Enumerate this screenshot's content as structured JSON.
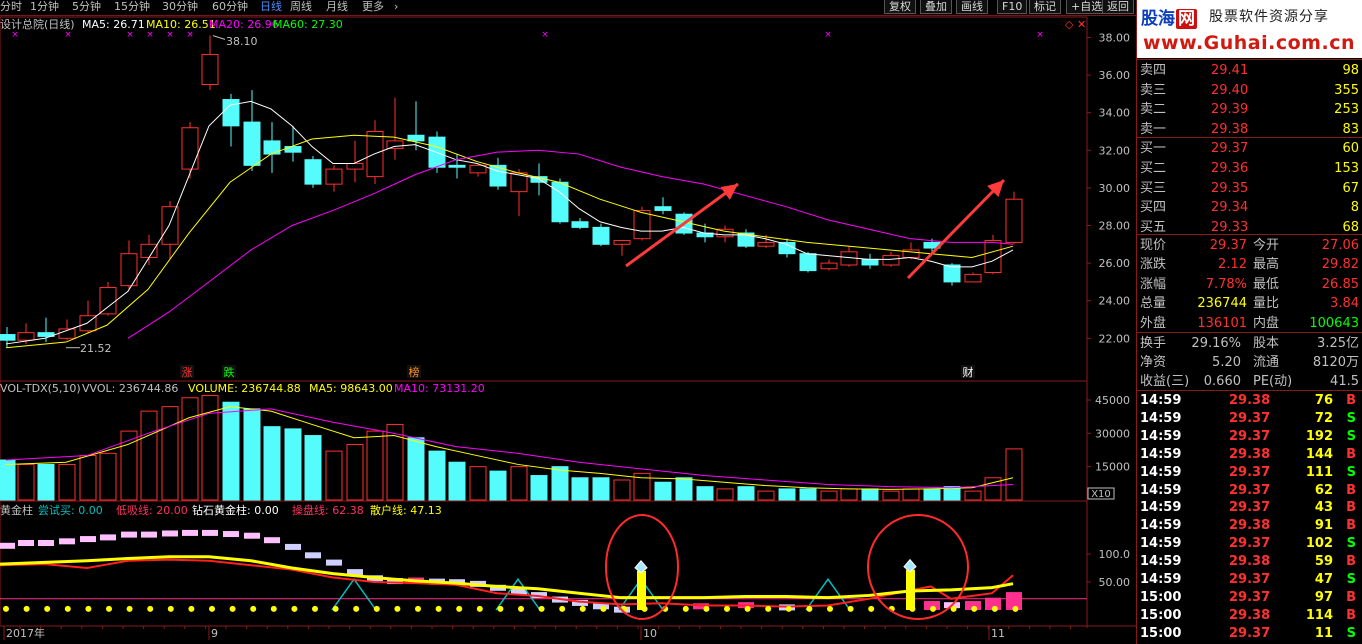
{
  "toolbar": {
    "periods": [
      "分时",
      "1分钟",
      "5分钟",
      "15分钟",
      "30分钟",
      "60分钟",
      "日线",
      "周线",
      "月线",
      "更多"
    ],
    "active_period": "日线",
    "more_arrow": "›",
    "right_buttons": [
      "复权",
      "叠加",
      "画线",
      "F10",
      "标记",
      "+自选",
      "返回"
    ]
  },
  "main_chart": {
    "title": "设计总院(日线)",
    "ma_labels": [
      {
        "text": "MA5: 26.71",
        "color": "#ffffff"
      },
      {
        "text": "MA10: 26.51",
        "color": "#ffff00"
      },
      {
        "text": "MA20: 26.96",
        "color": "#ff00ff"
      },
      {
        "text": "MA60: 27.30",
        "color": "#00ff00"
      }
    ],
    "price_ticks": [
      "38.00",
      "36.00",
      "34.00",
      "32.00",
      "30.00",
      "28.00",
      "26.00",
      "24.00",
      "22.00"
    ],
    "high_label": "38.10",
    "low_label": "21.52",
    "markers": [
      {
        "text": "涨",
        "color": "#ff3030"
      },
      {
        "text": "跌",
        "color": "#00ff00"
      },
      {
        "text": "榜",
        "color": "#ff9020"
      },
      {
        "text": "财",
        "color": "#ffffff"
      }
    ]
  },
  "volume_panel": {
    "labels": [
      {
        "text": "VOL-TDX(5,10)",
        "color": "#c0c0c0"
      },
      {
        "text": "VVOL: 236744.86",
        "color": "#c0c0c0"
      },
      {
        "text": "VOLUME: 236744.88",
        "color": "#ffff00"
      },
      {
        "text": "MA5: 98643.00",
        "color": "#ffff00"
      },
      {
        "text": "MA10: 73131.20",
        "color": "#ff00ff"
      }
    ],
    "ticks": [
      "45000",
      "30000",
      "15000"
    ],
    "unit": "X10"
  },
  "indicator_panel": {
    "labels": [
      {
        "text": "黄金柱",
        "color": "#c0c0c0"
      },
      {
        "text": "尝试买: 0.00",
        "color": "#00c0c0"
      },
      {
        "text": "低吸线: 20.00",
        "color": "#ff3060"
      },
      {
        "text": "钻石黄金柱: 0.00",
        "color": "#ffffff"
      },
      {
        "text": "操盘线: 62.38",
        "color": "#ff3060"
      },
      {
        "text": "散户线: 47.13",
        "color": "#ffff00"
      }
    ],
    "ticks": [
      "100.0",
      "50.00"
    ]
  },
  "date_axis": [
    "2017年",
    "9",
    "10",
    "11"
  ],
  "sidebar": {
    "banner": {
      "logo": "股海",
      "logo_net": "网",
      "slogan": "股票软件资源分享",
      "url": "www.Guhai.com.cn"
    },
    "order_book": [
      {
        "label": "卖四",
        "price": "29.41",
        "vol": "98"
      },
      {
        "label": "卖三",
        "price": "29.40",
        "vol": "355"
      },
      {
        "label": "卖二",
        "price": "29.39",
        "vol": "253"
      },
      {
        "label": "卖一",
        "price": "29.38",
        "vol": "83"
      },
      {
        "label": "买一",
        "price": "29.37",
        "vol": "60"
      },
      {
        "label": "买二",
        "price": "29.36",
        "vol": "153"
      },
      {
        "label": "买三",
        "price": "29.35",
        "vol": "67"
      },
      {
        "label": "买四",
        "price": "29.34",
        "vol": "8"
      },
      {
        "label": "买五",
        "price": "29.33",
        "vol": "68"
      }
    ],
    "quote": [
      {
        "l1": "现价",
        "v1": "29.37",
        "c1": "#ff3030",
        "l2": "今开",
        "v2": "27.06",
        "c2": "#ff3030"
      },
      {
        "l1": "涨跌",
        "v1": "2.12",
        "c1": "#ff3030",
        "l2": "最高",
        "v2": "29.82",
        "c2": "#ff3030"
      },
      {
        "l1": "涨幅",
        "v1": "7.78%",
        "c1": "#ff3030",
        "l2": "最低",
        "v2": "26.85",
        "c2": "#ff3030"
      },
      {
        "l1": "总量",
        "v1": "236744",
        "c1": "#ffff00",
        "l2": "量比",
        "v2": "3.84",
        "c2": "#ff3030"
      },
      {
        "l1": "外盘",
        "v1": "136101",
        "c1": "#ff3030",
        "l2": "内盘",
        "v2": "100643",
        "c2": "#00ff00"
      }
    ],
    "fundamentals": [
      {
        "l1": "换手",
        "v1": "29.16%",
        "l2": "股本",
        "v2": "3.25亿"
      },
      {
        "l1": "净资",
        "v1": "5.20",
        "l2": "流通",
        "v2": "8120万"
      },
      {
        "l1": "收益(三)",
        "v1": "0.660",
        "l2": "PE(动)",
        "v2": "41.5"
      }
    ],
    "trades": [
      {
        "time": "14:59",
        "price": "29.38",
        "vol": "76",
        "side": "B"
      },
      {
        "time": "14:59",
        "price": "29.37",
        "vol": "72",
        "side": "S"
      },
      {
        "time": "14:59",
        "price": "29.37",
        "vol": "192",
        "side": "S"
      },
      {
        "time": "14:59",
        "price": "29.38",
        "vol": "144",
        "side": "B"
      },
      {
        "time": "14:59",
        "price": "29.37",
        "vol": "111",
        "side": "S"
      },
      {
        "time": "14:59",
        "price": "29.37",
        "vol": "62",
        "side": "B"
      },
      {
        "time": "14:59",
        "price": "29.37",
        "vol": "43",
        "side": "B"
      },
      {
        "time": "14:59",
        "price": "29.38",
        "vol": "91",
        "side": "B"
      },
      {
        "time": "14:59",
        "price": "29.37",
        "vol": "102",
        "side": "S"
      },
      {
        "time": "14:59",
        "price": "29.38",
        "vol": "59",
        "side": "B"
      },
      {
        "time": "14:59",
        "price": "29.37",
        "vol": "47",
        "side": "S"
      },
      {
        "time": "15:00",
        "price": "29.37",
        "vol": "97",
        "side": "B"
      },
      {
        "time": "15:00",
        "price": "29.38",
        "vol": "114",
        "side": "B"
      },
      {
        "time": "15:00",
        "price": "29.37",
        "vol": "11",
        "side": "S"
      }
    ]
  },
  "colors": {
    "up": "#ff3030",
    "down": "#54fcfc",
    "grid": "#8a1a1a",
    "ma5": "#ffffff",
    "ma10": "#ffff00",
    "ma20": "#ff00ff"
  }
}
